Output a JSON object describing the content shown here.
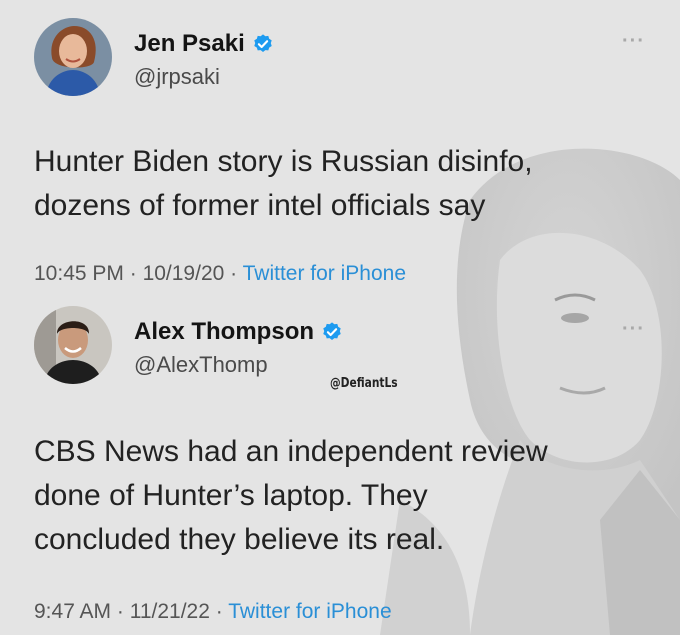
{
  "tweets": [
    {
      "name": "Jen Psaki",
      "handle": "@jrpsaki",
      "body": "Hunter Biden story is Russian disinfo,\ndozens of former intel officials say",
      "time": "10:45 PM",
      "date": "10/19/20",
      "source": "Twitter for iPhone",
      "more": "···"
    },
    {
      "name": "Alex Thompson",
      "handle": "@AlexThomp",
      "body": "CBS News had an independent review\ndone of Hunter’s laptop. They\nconcluded they believe its real.",
      "time": "9:47 AM",
      "date": "11/21/22",
      "source": "Twitter for iPhone",
      "more": "···"
    }
  ],
  "watermark": "@DefiantLs",
  "separator": " · ",
  "colors": {
    "background": "#e4e4e4",
    "link": "#2a8fd6",
    "verified": "#1d9bf0"
  },
  "icons": {
    "verified": "verified-badge-icon",
    "more": "more-options-icon"
  }
}
